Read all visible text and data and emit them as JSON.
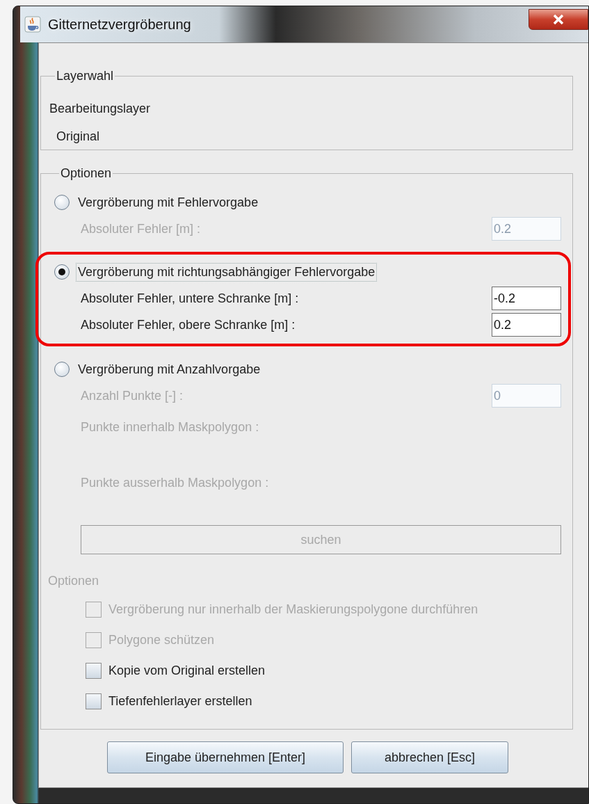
{
  "window": {
    "title": "Gitternetzvergröberung"
  },
  "layer_group": {
    "title": "Layerwahl",
    "label": "Bearbeitungslayer",
    "value": "Original"
  },
  "options_group": {
    "title": "Optionen",
    "modes": [
      {
        "label": "Vergröberung mit Fehlervorgabe",
        "selected": false,
        "highlighted": false,
        "rows": [
          {
            "kind": "field",
            "label": "Absoluter Fehler [m] :",
            "value": "0.2",
            "disabled": true
          }
        ]
      },
      {
        "label": "Vergröberung mit richtungsabhängiger Fehlervorgabe",
        "selected": true,
        "highlighted": true,
        "rows": [
          {
            "kind": "field",
            "label": "Absoluter Fehler, untere Schranke [m] :",
            "value": "-0.2",
            "disabled": false
          },
          {
            "kind": "field",
            "label": "Absoluter Fehler, obere Schranke [m] :",
            "value": "0.2",
            "disabled": false
          }
        ]
      },
      {
        "label": "Vergröberung mit Anzahlvorgabe",
        "selected": false,
        "highlighted": false,
        "rows": [
          {
            "kind": "field",
            "label": "Anzahl Punkte [-] :",
            "value": "0",
            "disabled": true
          },
          {
            "kind": "info",
            "label": "Punkte innerhalb Maskpolygon :",
            "disabled": true
          },
          {
            "kind": "info",
            "label": "Punkte ausserhalb Maskpolygon :",
            "disabled": true
          },
          {
            "kind": "button",
            "label": "suchen",
            "disabled": true
          }
        ]
      }
    ],
    "subtitle": "Optionen",
    "checkboxes": [
      {
        "label": "Vergröberung nur innerhalb der Maskierungspolygone durchführen",
        "checked": false,
        "disabled": true
      },
      {
        "label": "Polygone schützen",
        "checked": false,
        "disabled": true
      },
      {
        "label": "Kopie vom Original erstellen",
        "checked": false,
        "disabled": false
      },
      {
        "label": "Tiefenfehlerlayer erstellen",
        "checked": false,
        "disabled": false
      }
    ]
  },
  "buttons": [
    "Eingabe übernehmen [Enter]",
    "abbrechen [Esc]"
  ]
}
